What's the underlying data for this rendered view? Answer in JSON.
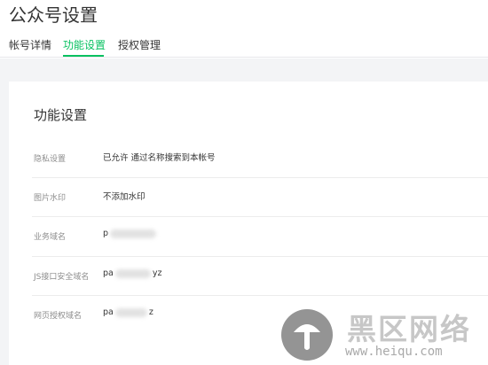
{
  "page": {
    "title": "公众号设置"
  },
  "tabs": [
    {
      "label": "帐号详情"
    },
    {
      "label": "功能设置",
      "active": true
    },
    {
      "label": "授权管理"
    }
  ],
  "section": {
    "title": "功能设置"
  },
  "settings": [
    {
      "label": "隐私设置",
      "value": "已允许 通过名称搜索到本帐号"
    },
    {
      "label": "图片水印",
      "value": "不添加水印"
    },
    {
      "label": "业务域名",
      "value_prefix": "p",
      "value_suffix": ""
    },
    {
      "label": "JS接口安全域名",
      "value_prefix": "pa",
      "value_suffix": "yz"
    },
    {
      "label": "网页授权域名",
      "value_prefix": "pa",
      "value_suffix": "z"
    }
  ],
  "watermark": {
    "text": "黑区网络",
    "url": "www.heiqu.com",
    "icon": "mushroom-logo-icon"
  },
  "colors": {
    "accent": "#07c160",
    "background": "#f3f4f6"
  }
}
